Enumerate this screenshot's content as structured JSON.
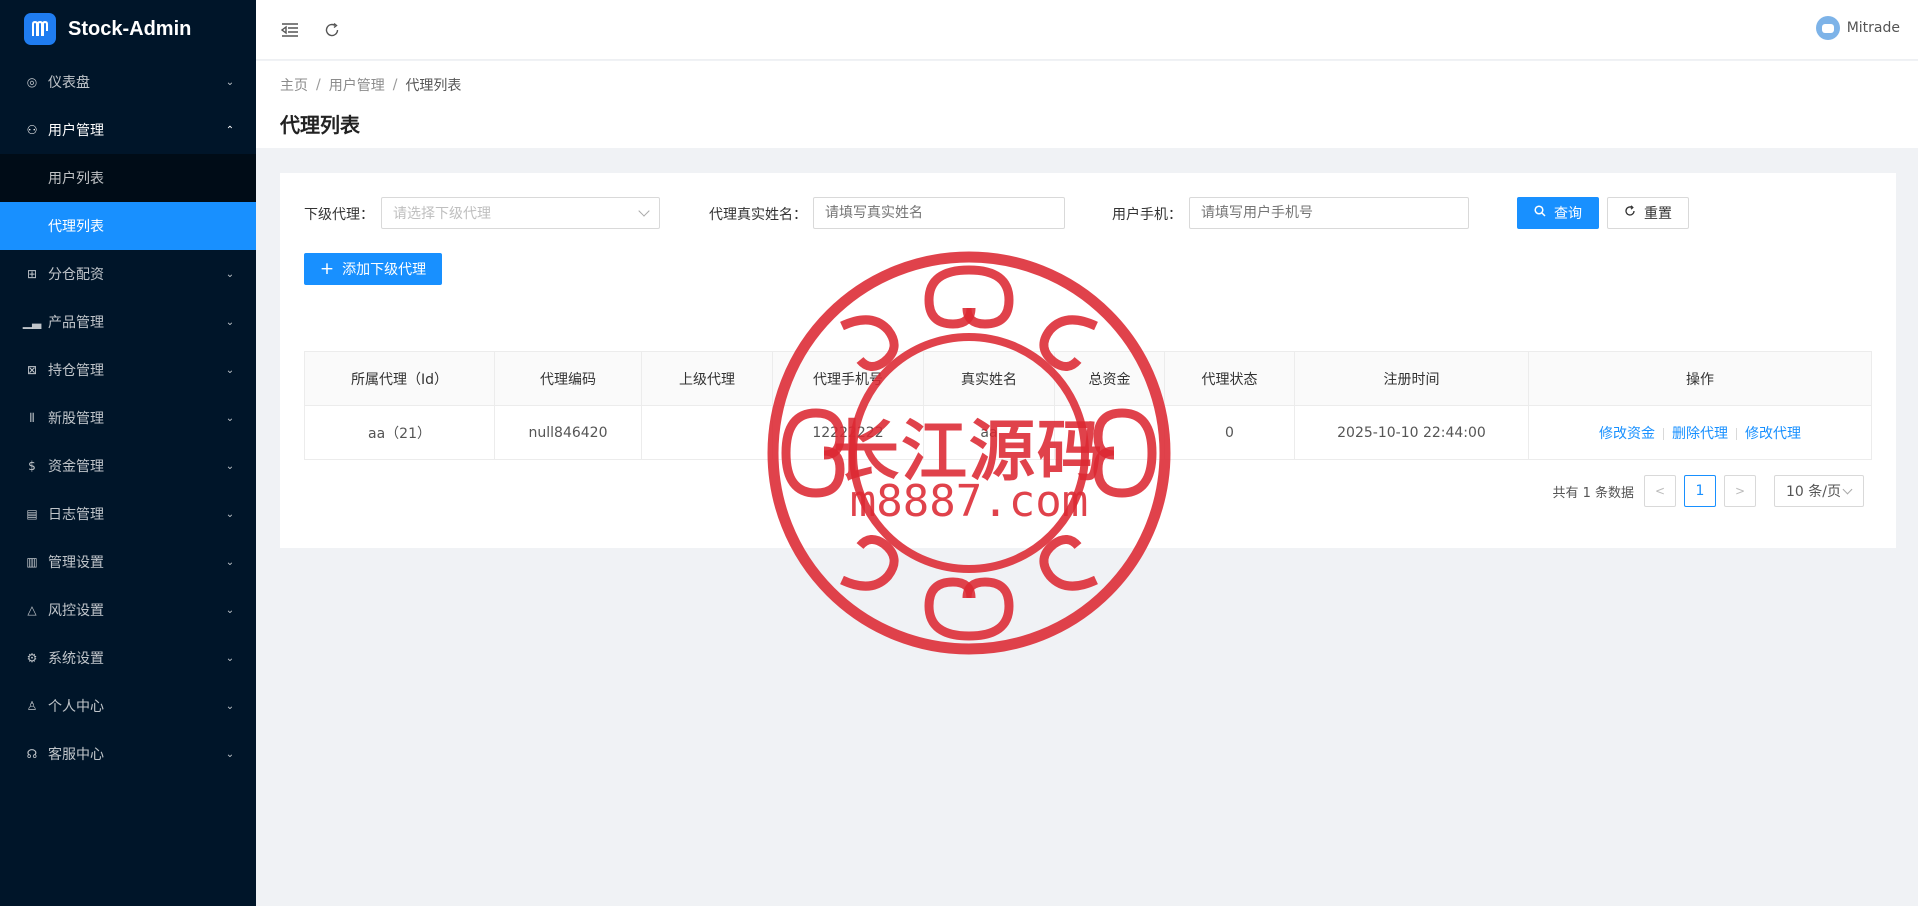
{
  "app": {
    "name": "Stock-Admin"
  },
  "sidebar": {
    "items": [
      {
        "label": "仪表盘",
        "icon": "dashboard-icon"
      },
      {
        "label": "用户管理",
        "icon": "user-manage-icon",
        "open": true,
        "children": [
          {
            "label": "用户列表"
          },
          {
            "label": "代理列表",
            "active": true
          }
        ]
      },
      {
        "label": "分仓配资",
        "icon": "sitemap-icon"
      },
      {
        "label": "产品管理",
        "icon": "chart-icon"
      },
      {
        "label": "持仓管理",
        "icon": "position-icon"
      },
      {
        "label": "新股管理",
        "icon": "new-stock-icon"
      },
      {
        "label": "资金管理",
        "icon": "money-icon"
      },
      {
        "label": "日志管理",
        "icon": "log-icon"
      },
      {
        "label": "管理设置",
        "icon": "settings-panel-icon"
      },
      {
        "label": "风控设置",
        "icon": "warning-icon"
      },
      {
        "label": "系统设置",
        "icon": "gear-icon"
      },
      {
        "label": "个人中心",
        "icon": "person-icon"
      },
      {
        "label": "客服中心",
        "icon": "headset-icon"
      }
    ]
  },
  "header": {
    "username": "Mitrade"
  },
  "breadcrumb": [
    "主页",
    "用户管理",
    "代理列表"
  ],
  "page_title": "代理列表",
  "filters": {
    "sub_agent_label": "下级代理：",
    "sub_agent_placeholder": "请选择下级代理",
    "real_name_label": "代理真实姓名：",
    "real_name_placeholder": "请填写真实姓名",
    "phone_label": "用户手机：",
    "phone_placeholder": "请填写用户手机号",
    "query_label": "查询",
    "reset_label": "重置"
  },
  "add_button_label": "添加下级代理",
  "table": {
    "columns": [
      "所属代理（Id）",
      "代理编码",
      "上级代理",
      "代理手机号",
      "真实姓名",
      "总资金",
      "代理状态",
      "注册时间",
      "操作"
    ],
    "rows": [
      {
        "owner": "aa（21）",
        "code": "null846420",
        "parent": "",
        "phone": "12222222",
        "name": "aa",
        "total": "",
        "status": "0",
        "reg_time": "2025-10-10 22:44:00"
      }
    ],
    "actions": [
      "修改资金",
      "删除代理",
      "修改代理"
    ]
  },
  "pagination": {
    "total_text": "共有 1 条数据",
    "current_page": "1",
    "page_size": "10 条/页"
  },
  "watermark": {
    "line1": "长江源码",
    "line2": "m8887.com"
  },
  "colors": {
    "sidebar_bg": "#001529",
    "primary": "#1890ff",
    "watermark": "#dc2832"
  }
}
